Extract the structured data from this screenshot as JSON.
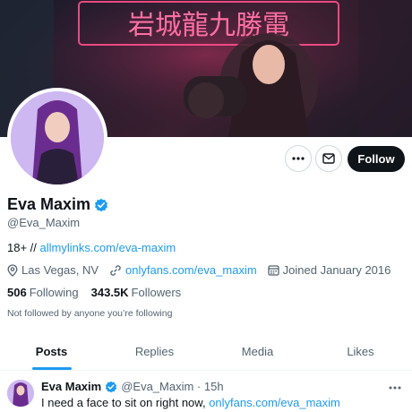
{
  "banner": {
    "sign_text": "岩城龍九勝電"
  },
  "profile": {
    "name": "Eva Maxim",
    "handle": "@Eva_Maxim",
    "verified_icon": "verified-badge-icon",
    "bio_prefix": "18+ // ",
    "bio_link": "allmylinks.com/eva-maxim",
    "location": "Las Vegas, NV",
    "website": "onlyfans.com/eva_maxim",
    "joined": "Joined January 2016",
    "following_count": "506",
    "following_label": "Following",
    "followers_count": "343.5K",
    "followers_label": "Followers",
    "not_followed_text": "Not followed by anyone you’re following"
  },
  "actions": {
    "more_icon": "more-horizontal-icon",
    "message_icon": "mail-icon",
    "follow_label": "Follow"
  },
  "tabs": [
    {
      "label": "Posts",
      "active": true
    },
    {
      "label": "Replies",
      "active": false
    },
    {
      "label": "Media",
      "active": false
    },
    {
      "label": "Likes",
      "active": false
    }
  ],
  "tweet": {
    "name": "Eva Maxim",
    "handle_time": "@Eva_Maxim · 15h",
    "text_prefix": "I need a face to sit on right now, ",
    "text_link": "onlyfans.com/eva_maxim"
  },
  "colors": {
    "accent": "#1d9bf0",
    "text": "#0f1419",
    "muted": "#536471",
    "follow_bg": "#0f1419"
  }
}
